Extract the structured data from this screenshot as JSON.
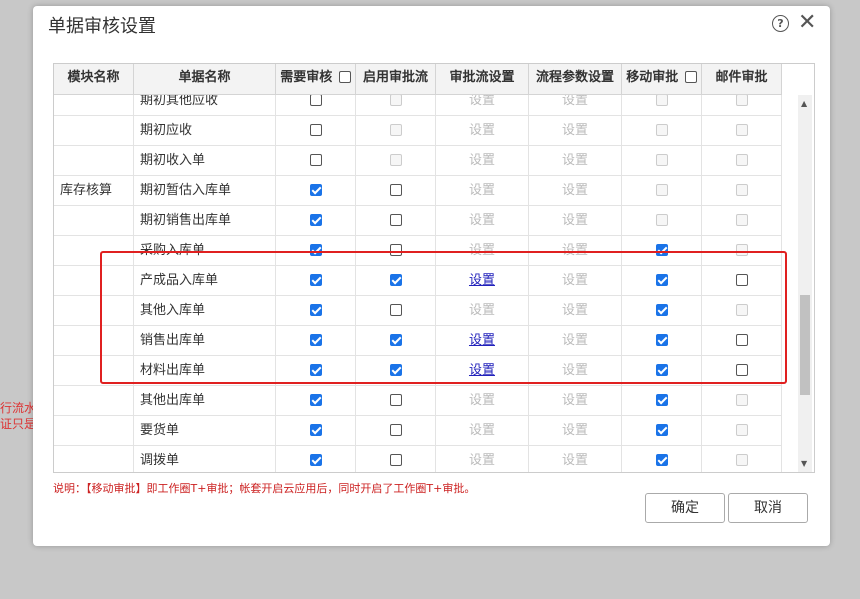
{
  "background": {
    "line1": "行流水",
    "line2": "证只是"
  },
  "dialog": {
    "title": "单据审核设置",
    "help_icon": "?",
    "close_icon": "✕"
  },
  "table": {
    "headers": {
      "module": "模块名称",
      "doc": "单据名称",
      "need_review": "需要审核",
      "enable_flow": "启用审批流",
      "flow_setting": "审批流设置",
      "param_setting": "流程参数设置",
      "mobile": "移动审批",
      "mail": "邮件审批"
    },
    "rows": [
      {
        "module": "",
        "doc": "期初其他应收",
        "need": false,
        "flow": false,
        "flow_dis": true,
        "flowset": "设置",
        "flowset_link": false,
        "param": "设置",
        "mobile": false,
        "mobile_dis": true,
        "mail": false,
        "mail_dis": true
      },
      {
        "module": "",
        "doc": "期初应收",
        "need": false,
        "flow": false,
        "flow_dis": true,
        "flowset": "设置",
        "flowset_link": false,
        "param": "设置",
        "mobile": false,
        "mobile_dis": true,
        "mail": false,
        "mail_dis": true
      },
      {
        "module": "",
        "doc": "期初收入单",
        "need": false,
        "flow": false,
        "flow_dis": true,
        "flowset": "设置",
        "flowset_link": false,
        "param": "设置",
        "mobile": false,
        "mobile_dis": true,
        "mail": false,
        "mail_dis": true
      },
      {
        "module": "库存核算",
        "doc": "期初暂估入库单",
        "need": true,
        "flow": false,
        "flow_dis": false,
        "flowset": "设置",
        "flowset_link": false,
        "param": "设置",
        "mobile": false,
        "mobile_dis": true,
        "mail": false,
        "mail_dis": true
      },
      {
        "module": "",
        "doc": "期初销售出库单",
        "need": true,
        "flow": false,
        "flow_dis": false,
        "flowset": "设置",
        "flowset_link": false,
        "param": "设置",
        "mobile": false,
        "mobile_dis": true,
        "mail": false,
        "mail_dis": true
      },
      {
        "module": "",
        "doc": "采购入库单",
        "need": true,
        "flow": false,
        "flow_dis": false,
        "flowset": "设置",
        "flowset_link": false,
        "param": "设置",
        "mobile": true,
        "mobile_dis": false,
        "mail": false,
        "mail_dis": true
      },
      {
        "module": "",
        "doc": "产成品入库单",
        "need": true,
        "flow": true,
        "flow_dis": false,
        "flowset": "设置",
        "flowset_link": true,
        "param": "设置",
        "mobile": true,
        "mobile_dis": false,
        "mail": false,
        "mail_dis": false
      },
      {
        "module": "",
        "doc": "其他入库单",
        "need": true,
        "flow": false,
        "flow_dis": false,
        "flowset": "设置",
        "flowset_link": false,
        "param": "设置",
        "mobile": true,
        "mobile_dis": false,
        "mail": false,
        "mail_dis": true
      },
      {
        "module": "",
        "doc": "销售出库单",
        "need": true,
        "flow": true,
        "flow_dis": false,
        "flowset": "设置",
        "flowset_link": true,
        "param": "设置",
        "mobile": true,
        "mobile_dis": false,
        "mail": false,
        "mail_dis": false
      },
      {
        "module": "",
        "doc": "材料出库单",
        "need": true,
        "flow": true,
        "flow_dis": false,
        "flowset": "设置",
        "flowset_link": true,
        "param": "设置",
        "mobile": true,
        "mobile_dis": false,
        "mail": false,
        "mail_dis": false
      },
      {
        "module": "",
        "doc": "其他出库单",
        "need": true,
        "flow": false,
        "flow_dis": false,
        "flowset": "设置",
        "flowset_link": false,
        "param": "设置",
        "mobile": true,
        "mobile_dis": false,
        "mail": false,
        "mail_dis": true
      },
      {
        "module": "",
        "doc": "要货单",
        "need": true,
        "flow": false,
        "flow_dis": false,
        "flowset": "设置",
        "flowset_link": false,
        "param": "设置",
        "mobile": true,
        "mobile_dis": false,
        "mail": false,
        "mail_dis": true
      },
      {
        "module": "",
        "doc": "调拨单",
        "need": true,
        "flow": false,
        "flow_dis": false,
        "flowset": "设置",
        "flowset_link": false,
        "param": "设置",
        "mobile": true,
        "mobile_dis": false,
        "mail": false,
        "mail_dis": true
      }
    ]
  },
  "note": "说明：【移动审批】即工作圈T+审批；帐套开启云应用后，同时开启了工作圈T+审批。",
  "buttons": {
    "ok": "确定",
    "cancel": "取消"
  },
  "colors": {
    "accent": "#1a73e8",
    "highlight": "#e02020",
    "note": "#cc2222"
  }
}
